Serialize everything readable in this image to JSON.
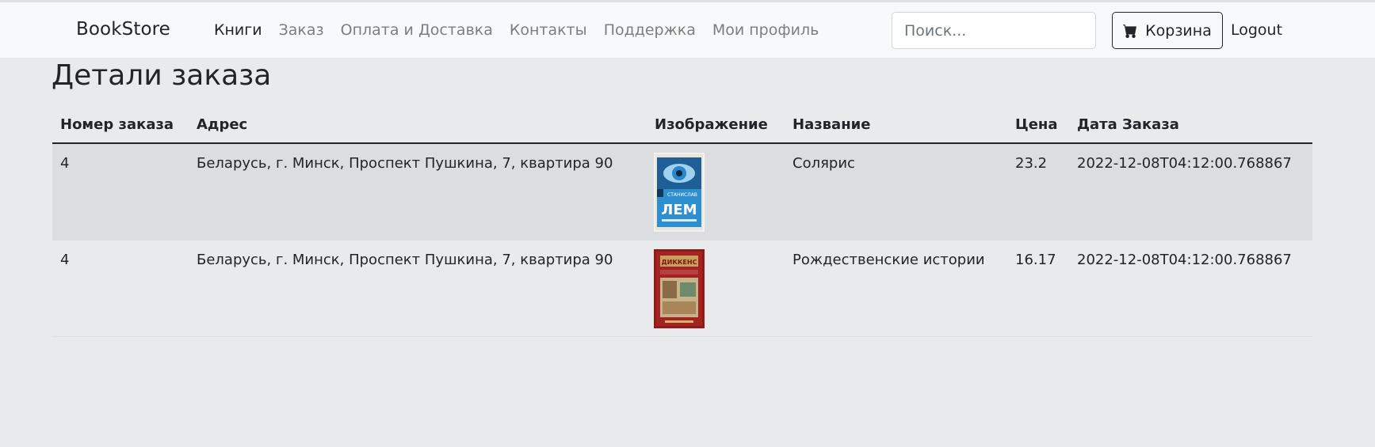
{
  "navbar": {
    "brand": "BookStore",
    "links": [
      {
        "label": "Книги",
        "active": true
      },
      {
        "label": "Заказ",
        "active": false
      },
      {
        "label": "Оплата и Доставка",
        "active": false
      },
      {
        "label": "Контакты",
        "active": false
      },
      {
        "label": "Поддержка",
        "active": false
      },
      {
        "label": "Мои профиль",
        "active": false
      }
    ],
    "search_placeholder": "Поиск...",
    "search_value": "",
    "cart_label": "Корзина",
    "logout_label": "Logout"
  },
  "main": {
    "title": "Детали заказа",
    "table": {
      "headers": [
        "Номер заказа",
        "Адрес",
        "Изображение",
        "Название",
        "Цена",
        "Дата Заказа"
      ],
      "rows": [
        {
          "order_number": "4",
          "address": "Беларусь, г. Минск, Проспект Пушкина, 7, квартира 90",
          "image": "solaris-book-cover",
          "cover_lines": [
            "СТАНИСЛАВ",
            "ЛЕМ"
          ],
          "title": "Солярис",
          "price": "23.2",
          "date": "2022-12-08T04:12:00.768867"
        },
        {
          "order_number": "4",
          "address": "Беларусь, г. Минск, Проспект Пушкина, 7, квартира 90",
          "image": "christmas-stories-book-cover",
          "cover_lines": [
            "ДИККЕНС"
          ],
          "title": "Рождественские истории",
          "price": "16.17",
          "date": "2022-12-08T04:12:00.768867"
        }
      ]
    }
  },
  "colors": {
    "page_bg": "#e9eaec",
    "navbar_bg": "#f8f9fa",
    "text": "#212529",
    "muted_link": "#7a7e83",
    "striped_row": "#dcdde0"
  }
}
